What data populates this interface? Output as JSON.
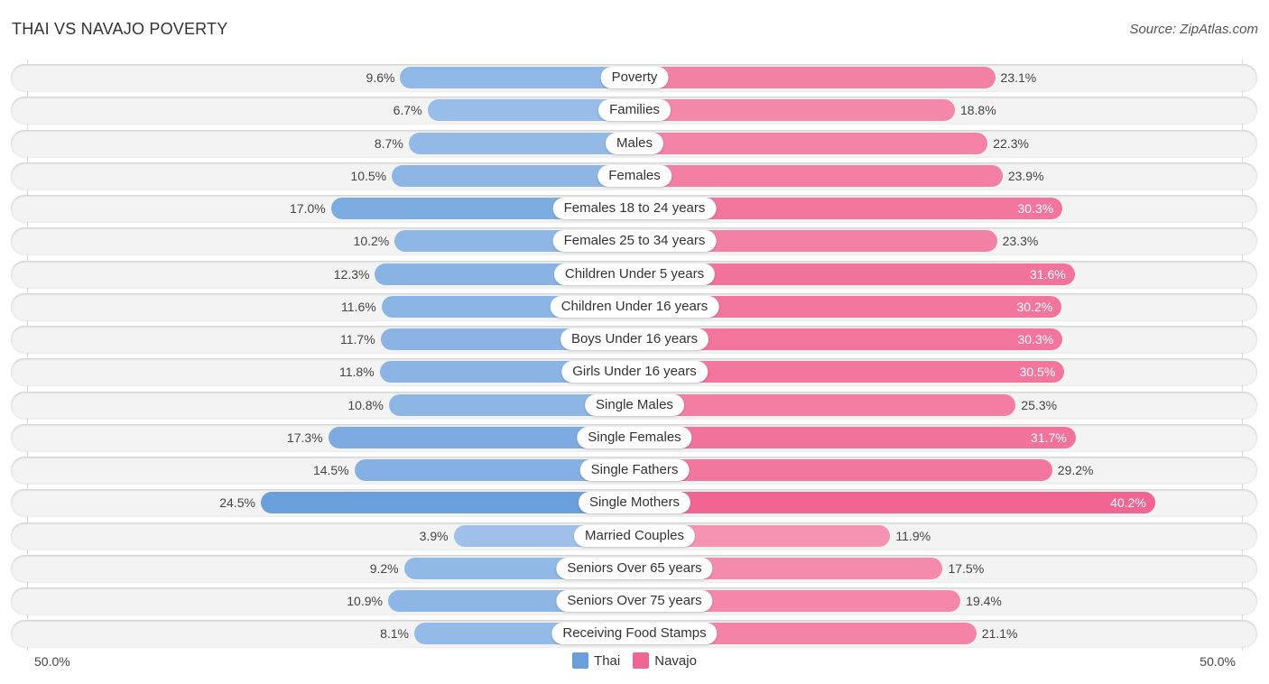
{
  "header": {
    "title": "THAI VS NAVAJO POVERTY",
    "source": "Source: ZipAtlas.com"
  },
  "colors": {
    "thai": "#6a9fdc",
    "thai_light": "#a9c8ec",
    "navajo": "#f06592",
    "navajo_light": "#f7a6c0"
  },
  "chart_data": {
    "type": "bar",
    "orientation": "horizontal-diverging",
    "title": "THAI VS NAVAJO POVERTY",
    "categories": [
      "Poverty",
      "Families",
      "Males",
      "Females",
      "Females 18 to 24 years",
      "Females 25 to 34 years",
      "Children Under 5 years",
      "Children Under 16 years",
      "Boys Under 16 years",
      "Girls Under 16 years",
      "Single Males",
      "Single Females",
      "Single Fathers",
      "Single Mothers",
      "Married Couples",
      "Seniors Over 65 years",
      "Seniors Over 75 years",
      "Receiving Food Stamps"
    ],
    "series": [
      {
        "name": "Thai",
        "values": [
          9.6,
          6.7,
          8.7,
          10.5,
          17.0,
          10.2,
          12.3,
          11.6,
          11.7,
          11.8,
          10.8,
          17.3,
          14.5,
          24.5,
          3.9,
          9.2,
          10.9,
          8.1
        ],
        "labels": [
          "9.6%",
          "6.7%",
          "8.7%",
          "10.5%",
          "17.0%",
          "10.2%",
          "12.3%",
          "11.6%",
          "11.7%",
          "11.8%",
          "10.8%",
          "17.3%",
          "14.5%",
          "24.5%",
          "3.9%",
          "9.2%",
          "10.9%",
          "8.1%"
        ]
      },
      {
        "name": "Navajo",
        "values": [
          23.1,
          18.8,
          22.3,
          23.9,
          30.3,
          23.3,
          31.6,
          30.2,
          30.3,
          30.5,
          25.3,
          31.7,
          29.2,
          40.2,
          11.9,
          17.5,
          19.4,
          21.1
        ],
        "labels": [
          "23.1%",
          "18.8%",
          "22.3%",
          "23.9%",
          "30.3%",
          "23.3%",
          "31.6%",
          "30.2%",
          "30.3%",
          "30.5%",
          "25.3%",
          "31.7%",
          "29.2%",
          "40.2%",
          "11.9%",
          "17.5%",
          "19.4%",
          "21.1%"
        ]
      }
    ],
    "axis": {
      "left_label": "50.0%",
      "right_label": "50.0%",
      "range": [
        0,
        50
      ]
    },
    "legend": {
      "position": "bottom-center",
      "items": [
        "Thai",
        "Navajo"
      ]
    },
    "grid": false
  }
}
